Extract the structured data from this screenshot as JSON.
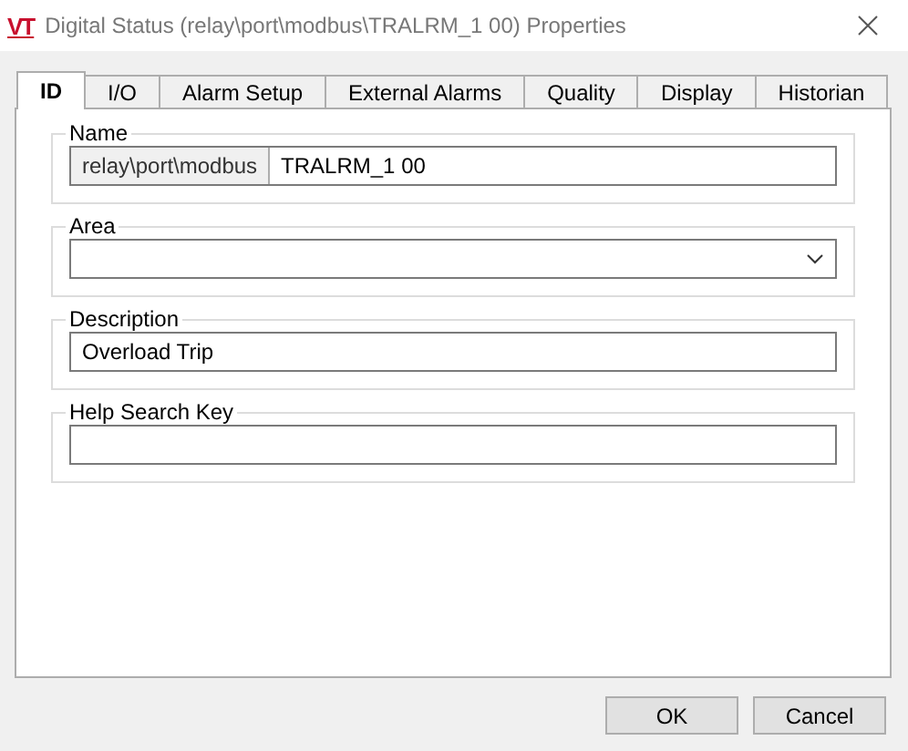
{
  "window": {
    "logo": "VT",
    "title": "Digital Status (relay\\port\\modbus\\TRALRM_1 00) Properties"
  },
  "tabs": [
    {
      "label": "ID",
      "selected": true
    },
    {
      "label": "I/O",
      "selected": false
    },
    {
      "label": "Alarm Setup",
      "selected": false
    },
    {
      "label": "External Alarms",
      "selected": false
    },
    {
      "label": "Quality",
      "selected": false
    },
    {
      "label": "Display",
      "selected": false
    },
    {
      "label": "Historian",
      "selected": false
    }
  ],
  "groups": [
    {
      "kind": "prefixed",
      "label": "Name",
      "prefix": "relay\\port\\modbus",
      "value": "TRALRM_1 00"
    },
    {
      "kind": "dropdown",
      "label": "Area"
    },
    {
      "kind": "text",
      "label": "Description",
      "value": "Overload Trip"
    },
    {
      "kind": "text",
      "label": "Help Search Key"
    }
  ],
  "buttons": [
    "OK",
    "Cancel"
  ]
}
